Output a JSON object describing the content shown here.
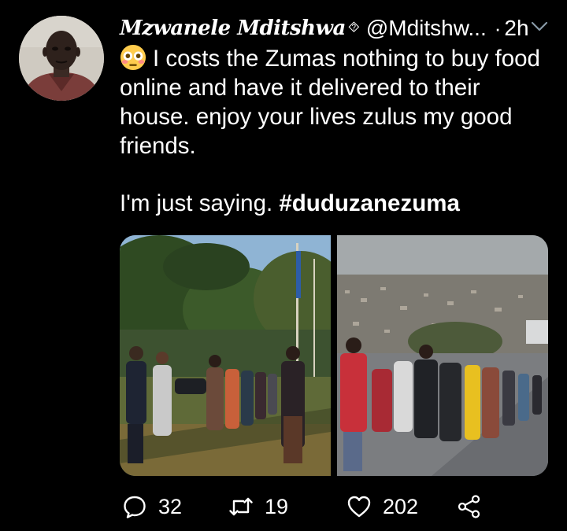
{
  "tweet": {
    "display_name": "Mzwanele Mditshwa",
    "name_badge": "⯑",
    "handle": "@Mditshw...",
    "separator": "·",
    "time": "2h",
    "text_line1": "I costs the Zumas nothing to buy food online and have it delivered to their house. enjoy your lives zulus my good friends.",
    "text_line2": "I'm just saying.",
    "hashtag": "#duduzanezuma",
    "emoji": "flushed-face-emoji"
  },
  "media": {
    "count": 2,
    "photos": [
      "queue-at-gate-photo",
      "queue-on-road-photo"
    ]
  },
  "actions": {
    "reply_count": "32",
    "retweet_count": "19",
    "like_count": "202",
    "icons": [
      "reply-icon",
      "retweet-icon",
      "like-icon",
      "share-icon"
    ]
  },
  "colors": {
    "background": "#000000",
    "text": "#ffffff",
    "icon": "#ffffff"
  }
}
